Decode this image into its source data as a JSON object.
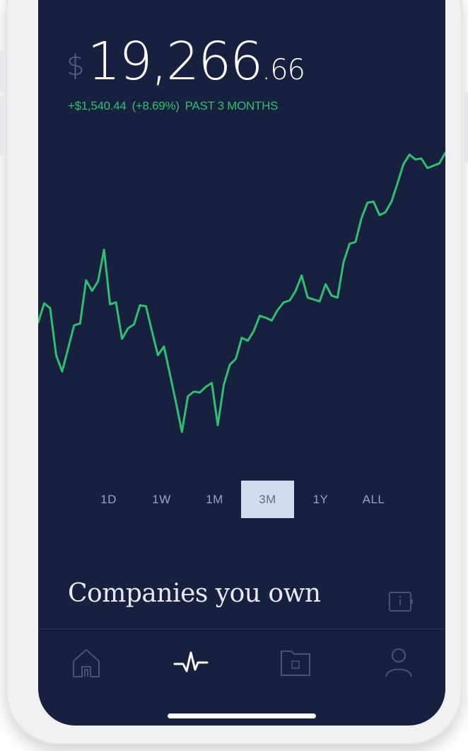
{
  "portfolio": {
    "currency_symbol": "$",
    "value_whole": "19,266",
    "value_cents": ".66",
    "change_amount": "+$1,540.44",
    "change_percent": "(+8.69%)",
    "change_period": "PAST 3 MONTHS"
  },
  "chart_data": {
    "type": "line",
    "title": "",
    "xlabel": "",
    "ylabel": "",
    "grid": false,
    "line_color": "#2fc06f",
    "x": [
      0,
      1,
      2,
      3,
      4,
      5,
      6,
      7,
      8,
      9,
      10,
      11,
      12,
      13,
      14,
      15,
      16,
      17,
      18,
      19,
      20,
      21,
      22,
      23,
      24,
      25,
      26,
      27,
      28,
      29,
      30,
      31,
      32,
      33,
      34,
      35,
      36,
      37,
      38,
      39,
      40,
      41,
      42,
      43,
      44,
      45,
      46,
      47,
      48,
      49,
      50,
      51,
      52,
      53,
      54,
      55,
      56,
      57,
      58,
      59,
      60,
      61,
      62,
      63,
      64,
      65,
      66,
      67,
      68
    ],
    "values": [
      17650,
      17850,
      17800,
      17310,
      17140,
      17380,
      17620,
      17640,
      18090,
      17980,
      18080,
      18410,
      17840,
      17860,
      17480,
      17590,
      17630,
      17830,
      17820,
      17560,
      17310,
      17400,
      17110,
      16820,
      16510,
      16880,
      16930,
      16920,
      16980,
      17020,
      16580,
      17000,
      17210,
      17270,
      17490,
      17460,
      17560,
      17720,
      17700,
      17670,
      17780,
      17860,
      17880,
      17980,
      18140,
      17910,
      17890,
      17870,
      18050,
      17930,
      17910,
      18280,
      18470,
      18490,
      18740,
      18900,
      18910,
      18770,
      18800,
      18910,
      19100,
      19300,
      19400,
      19350,
      19360,
      19260,
      19285,
      19310,
      19420
    ],
    "ylim": [
      16400,
      19500
    ]
  },
  "ranges": {
    "items": [
      {
        "label": "1D"
      },
      {
        "label": "1W"
      },
      {
        "label": "1M"
      },
      {
        "label": "3M"
      },
      {
        "label": "1Y"
      },
      {
        "label": "ALL"
      }
    ],
    "active_index": 3
  },
  "section": {
    "title": "Companies you own",
    "info_icon": "info-card-icon"
  },
  "tabbar": {
    "items": [
      {
        "icon": "home-icon"
      },
      {
        "icon": "activity-icon",
        "active": true
      },
      {
        "icon": "folder-icon"
      },
      {
        "icon": "profile-icon"
      }
    ]
  },
  "colors": {
    "screen_bg": "#18203f",
    "positive": "#2fc06f",
    "range_active_bg": "#d2dcf0",
    "text_muted": "#9aa3c0",
    "icon_muted": "#4a5272"
  }
}
